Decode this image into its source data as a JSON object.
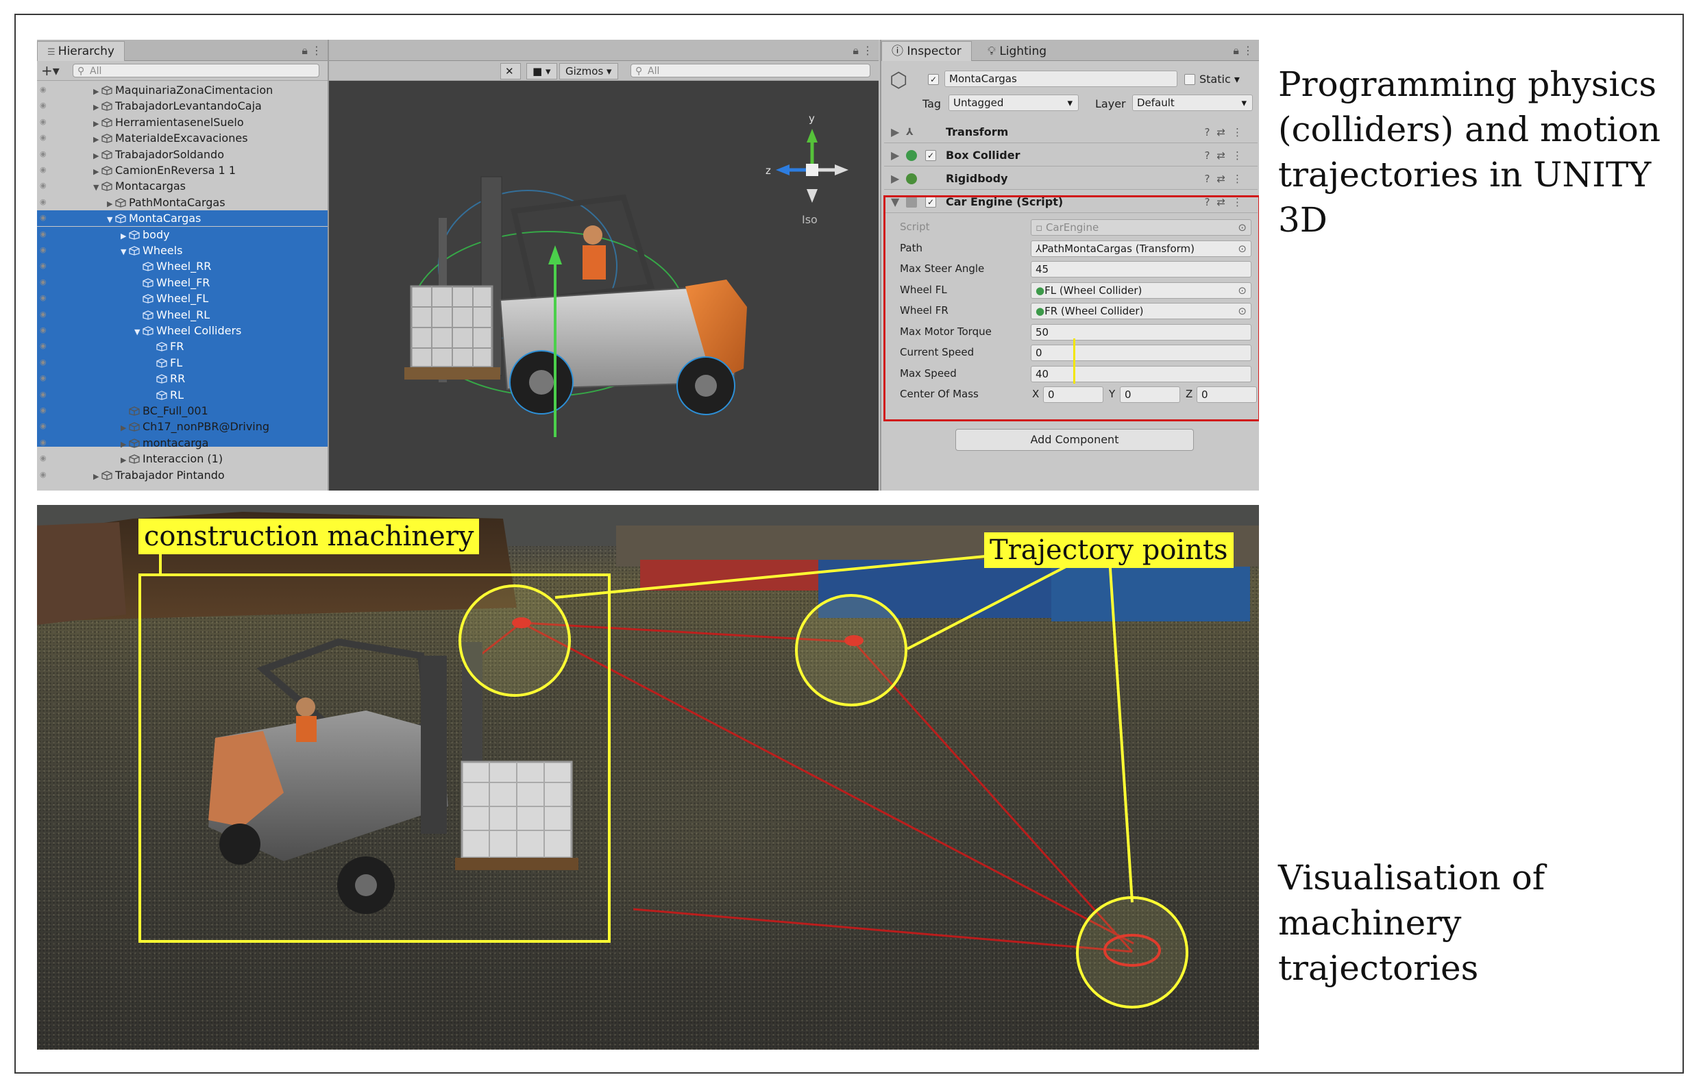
{
  "captions": {
    "top_right": [
      "Programming physics",
      "(colliders) and motion",
      "trajectories in UNITY",
      "3D"
    ],
    "bottom_right": [
      "Visualisation of",
      "machinery",
      "trajectories"
    ]
  },
  "hierarchy": {
    "tab_label": "Hierarchy",
    "search_placeholder": "All",
    "items": [
      {
        "label": "MaquinariaZonaCimentacion",
        "depth": 1,
        "selected": false,
        "arrow": "▶"
      },
      {
        "label": "TrabajadorLevantandoCaja",
        "depth": 1,
        "selected": false,
        "arrow": "▶"
      },
      {
        "label": "HerramientasenelSuelo",
        "depth": 1,
        "selected": false,
        "arrow": "▶"
      },
      {
        "label": "MaterialdeExcavaciones",
        "depth": 1,
        "selected": false,
        "arrow": "▶"
      },
      {
        "label": "TrabajadorSoldando",
        "depth": 1,
        "selected": false,
        "arrow": "▶"
      },
      {
        "label": "CamionEnReversa 1 1",
        "depth": 1,
        "selected": false,
        "arrow": "▶"
      },
      {
        "label": "Montacargas",
        "depth": 1,
        "selected": false,
        "arrow": "▼"
      },
      {
        "label": "PathMontaCargas",
        "depth": 2,
        "selected": false,
        "arrow": "▶"
      },
      {
        "label": "MontaCargas",
        "depth": 2,
        "selected": true,
        "arrow": "▼"
      },
      {
        "label": "body",
        "depth": 3,
        "selected": true,
        "arrow": "▶"
      },
      {
        "label": "Wheels",
        "depth": 3,
        "selected": true,
        "arrow": "▼"
      },
      {
        "label": "Wheel_RR",
        "depth": 4,
        "selected": true,
        "arrow": ""
      },
      {
        "label": "Wheel_FR",
        "depth": 4,
        "selected": true,
        "arrow": ""
      },
      {
        "label": "Wheel_FL",
        "depth": 4,
        "selected": true,
        "arrow": ""
      },
      {
        "label": "Wheel_RL",
        "depth": 4,
        "selected": true,
        "arrow": ""
      },
      {
        "label": "Wheel Colliders",
        "depth": 4,
        "selected": true,
        "arrow": "▼"
      },
      {
        "label": "FR",
        "depth": 5,
        "selected": true,
        "arrow": ""
      },
      {
        "label": "FL",
        "depth": 5,
        "selected": true,
        "arrow": ""
      },
      {
        "label": "RR",
        "depth": 5,
        "selected": true,
        "arrow": ""
      },
      {
        "label": "RL",
        "depth": 5,
        "selected": true,
        "arrow": ""
      },
      {
        "label": "BC_Full_001",
        "depth": 3,
        "selected": false,
        "arrow": ""
      },
      {
        "label": "Ch17_nonPBR@Driving",
        "depth": 3,
        "selected": false,
        "arrow": "▶"
      },
      {
        "label": "montacarga",
        "depth": 3,
        "selected": false,
        "arrow": "▶"
      },
      {
        "label": "Interaccion (1)",
        "depth": 3,
        "selected": false,
        "arrow": "▶"
      },
      {
        "label": "Trabajador Pintando",
        "depth": 1,
        "selected": false,
        "arrow": "▶"
      }
    ]
  },
  "scene": {
    "tools_icon": "tools-icon",
    "camera_button": "▾",
    "gizmos_label": "Gizmos",
    "search_placeholder": "All",
    "persp_label": "Iso",
    "axis_y": "y",
    "axis_z": "z"
  },
  "inspector": {
    "tabs": [
      "Inspector",
      "Lighting"
    ],
    "object_name": "MontaCargas",
    "static_label": "Static",
    "tag_label": "Tag",
    "tag_value": "Untagged",
    "layer_label": "Layer",
    "layer_value": "Default",
    "components": [
      {
        "name": "Transform",
        "icon_color": "#6a6a6a"
      },
      {
        "name": "Box Collider",
        "icon_color": "#3d9a4a"
      },
      {
        "name": "Rigidbody",
        "icon_color": "#4a8f3a"
      },
      {
        "name": "Car Engine (Script)",
        "icon_color": "#8a8a8a"
      }
    ],
    "properties": [
      {
        "label": "Script",
        "value": "CarEngine"
      },
      {
        "label": "Path",
        "value": "PathMontaCargas (Transform)"
      },
      {
        "label": "Max Steer Angle",
        "value": "45"
      },
      {
        "label": "Wheel FL",
        "value": "FL (Wheel Collider)"
      },
      {
        "label": "Wheel FR",
        "value": "FR (Wheel Collider)"
      },
      {
        "label": "Max Motor Torque",
        "value": "50"
      },
      {
        "label": "Current Speed",
        "value": "0"
      },
      {
        "label": "Max Speed",
        "value": "40"
      },
      {
        "label": "Center Of Mass",
        "value": ""
      }
    ],
    "center_of_mass": {
      "x_label": "X",
      "x": "0",
      "y_label": "Y",
      "y": "0",
      "z_label": "Z",
      "z": "0"
    },
    "add_component": "Add Component",
    "highlight_color": "#d11a1a"
  },
  "game": {
    "label_machinery": "construction machinery",
    "label_points": "Trajectory points",
    "annotation_color": "#ffff33",
    "path_color": "#d01818"
  }
}
